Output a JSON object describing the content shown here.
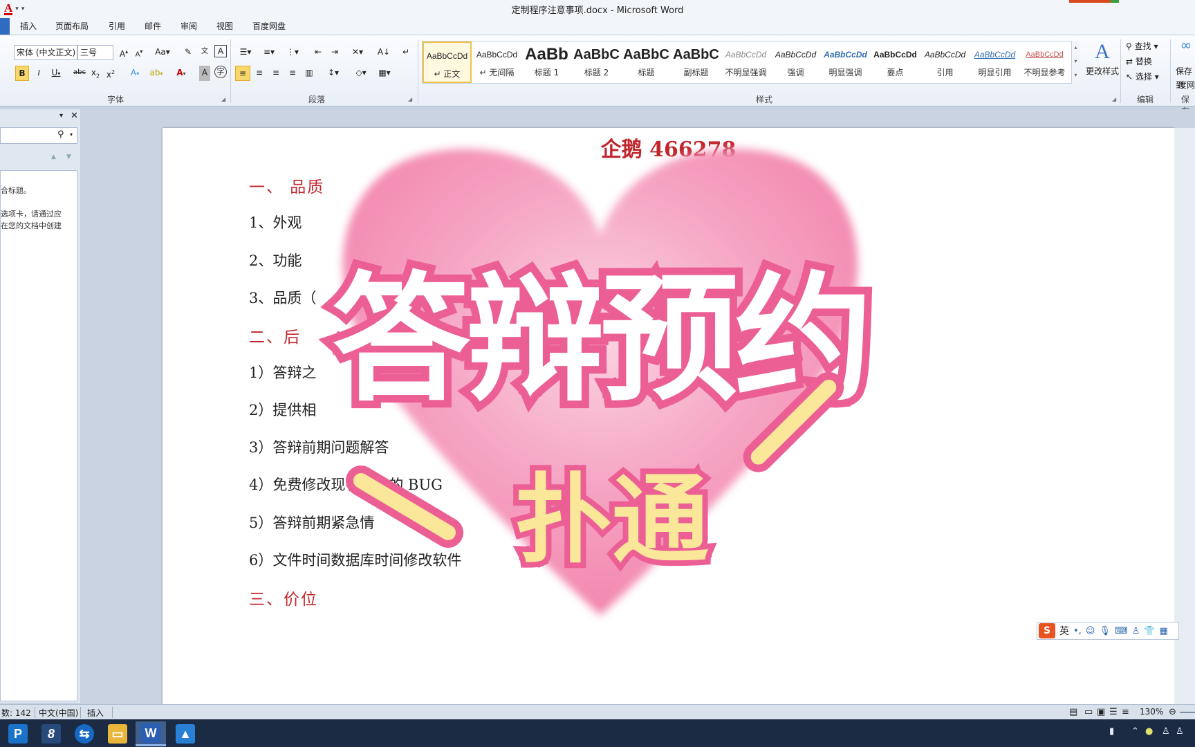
{
  "window": {
    "title": "定制程序注意事项.docx - Microsoft Word"
  },
  "tabs": [
    "插入",
    "页面布局",
    "引用",
    "邮件",
    "审阅",
    "视图",
    "百度网盘"
  ],
  "ribbon": {
    "font_name": "宋体 (中文正文)",
    "font_size": "三号",
    "groups": {
      "font": "字体",
      "paragraph": "段落",
      "styles": "样式",
      "editing": "编辑",
      "save_partial": "保存"
    },
    "styles": [
      {
        "sample": "AaBbCcDd",
        "name": "正文"
      },
      {
        "sample": "AaBbCcDd",
        "name": "无间隔"
      },
      {
        "sample": "AaBb",
        "name": "标题 1"
      },
      {
        "sample": "AaBbC",
        "name": "标题 2"
      },
      {
        "sample": "AaBbC",
        "name": "标题"
      },
      {
        "sample": "AaBbC",
        "name": "副标题"
      },
      {
        "sample": "AaBbCcDd",
        "name": "不明显强调"
      },
      {
        "sample": "AaBbCcDd",
        "name": "强调"
      },
      {
        "sample": "AaBbCcDd",
        "name": "明显强调"
      },
      {
        "sample": "AaBbCcDd",
        "name": "要点"
      },
      {
        "sample": "AaBbCcDd",
        "name": "引用"
      },
      {
        "sample": "AaBbCcDd",
        "name": "明显引用"
      },
      {
        "sample": "AaBbCcDd",
        "name": "不明显参考"
      }
    ],
    "change_styles": "更改样式",
    "find": "查找",
    "replace": "替换",
    "select": "选择",
    "save_partial2": "保存到",
    "save_partial3": "度网"
  },
  "nav_pane": {
    "text_lines": [
      "合标题。",
      "选项卡，请通过应",
      "在您的文档中创建"
    ]
  },
  "document": {
    "top_line": "企鹅 466278",
    "lines": [
      {
        "text": "一、 品质",
        "heading": true
      },
      {
        "text": "1、外观",
        "heading": false
      },
      {
        "text": "2、功能",
        "heading": false
      },
      {
        "text": "3、品质（",
        "heading": false
      },
      {
        "text": "二、后",
        "heading": true
      },
      {
        "text": "1）答辩之",
        "heading": false
      },
      {
        "text": "2）提供相",
        "heading": false
      },
      {
        "text": "3）答辩前期问题解答",
        "heading": false
      },
      {
        "text": "4）免费修改现有功能的 BUG",
        "heading": false
      },
      {
        "text": "5）答辩前期紧急情",
        "heading": false
      },
      {
        "text": "6）文件时间数据库时间修改软件",
        "heading": false
      },
      {
        "text": "三、价位",
        "heading": true
      }
    ]
  },
  "overlay": {
    "big_text": "答辩预约",
    "small_text": "扑通"
  },
  "ime": {
    "logo": "S",
    "mode": "英"
  },
  "statusbar": {
    "word_count": "数: 142",
    "language": "中文(中国)",
    "mode": "插入",
    "zoom": "130%"
  },
  "colors": {
    "heading_red": "#c0272d",
    "sticker_pink": "#ec5f95",
    "heart_pink": "#f58db5"
  }
}
